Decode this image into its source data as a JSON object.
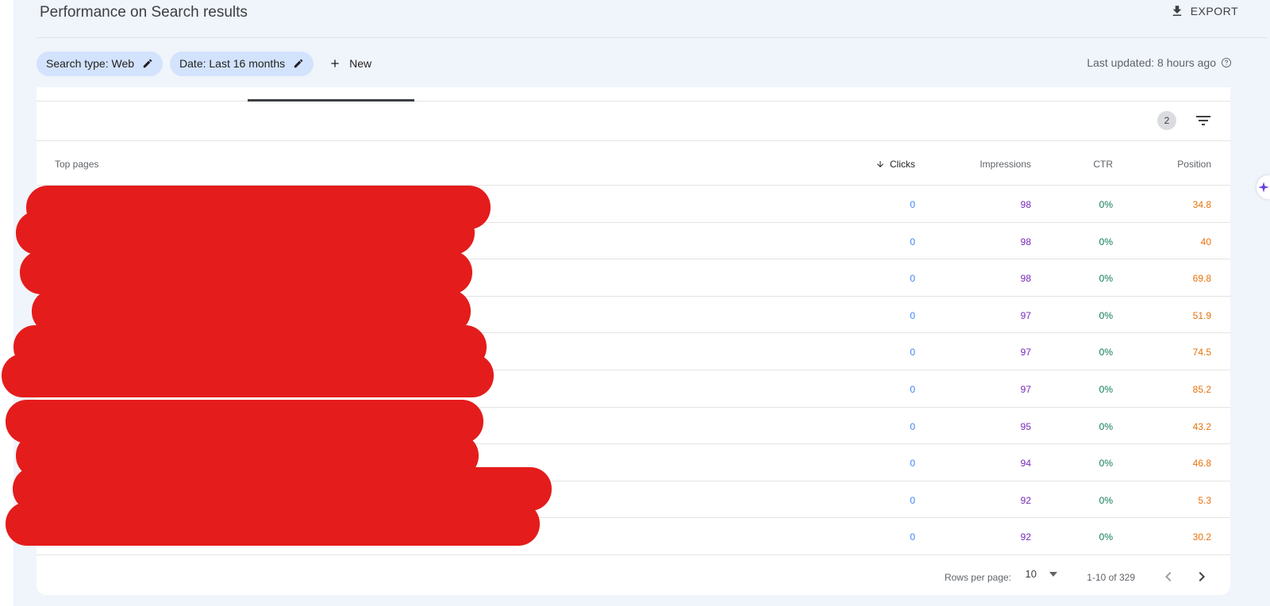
{
  "header": {
    "title": "Performance on Search results",
    "export_label": "EXPORT"
  },
  "filters": {
    "chips": [
      {
        "label": "Search type: Web"
      },
      {
        "label": "Date: Last 16 months"
      }
    ],
    "new_label": "New",
    "last_updated": "Last updated: 8 hours ago"
  },
  "toolbar": {
    "filter_count": "2"
  },
  "table": {
    "columns": {
      "pages": "Top pages",
      "clicks": "Clicks",
      "impressions": "Impressions",
      "ctr": "CTR",
      "position": "Position"
    },
    "rows": [
      {
        "clicks": "0",
        "impressions": "98",
        "ctr": "0%",
        "position": "34.8"
      },
      {
        "clicks": "0",
        "impressions": "98",
        "ctr": "0%",
        "position": "40"
      },
      {
        "clicks": "0",
        "impressions": "98",
        "ctr": "0%",
        "position": "69.8"
      },
      {
        "clicks": "0",
        "impressions": "97",
        "ctr": "0%",
        "position": "51.9"
      },
      {
        "clicks": "0",
        "impressions": "97",
        "ctr": "0%",
        "position": "74.5"
      },
      {
        "clicks": "0",
        "impressions": "97",
        "ctr": "0%",
        "position": "85.2"
      },
      {
        "clicks": "0",
        "impressions": "95",
        "ctr": "0%",
        "position": "43.2"
      },
      {
        "clicks": "0",
        "impressions": "94",
        "ctr": "0%",
        "position": "46.8"
      },
      {
        "clicks": "0",
        "impressions": "92",
        "ctr": "0%",
        "position": "5.3"
      },
      {
        "clicks": "0",
        "impressions": "92",
        "ctr": "0%",
        "position": "30.2"
      }
    ]
  },
  "pagination": {
    "rows_per_page_label": "Rows per page:",
    "rows_per_page_value": "10",
    "range": "1-10 of 329"
  },
  "colors": {
    "clicks": "#4285f4",
    "impressions": "#7627bb",
    "ctr": "#0f7a5a",
    "position": "#e8710a",
    "chip_bg": "#d3e3fd",
    "redaction": "#e41c1c"
  },
  "icons": [
    "download-icon",
    "edit-icon",
    "plus-icon",
    "help-icon",
    "filter-icon",
    "arrow-down-icon",
    "dropdown-arrow-icon",
    "chevron-left-icon",
    "chevron-right-icon",
    "sparkle-icon"
  ]
}
